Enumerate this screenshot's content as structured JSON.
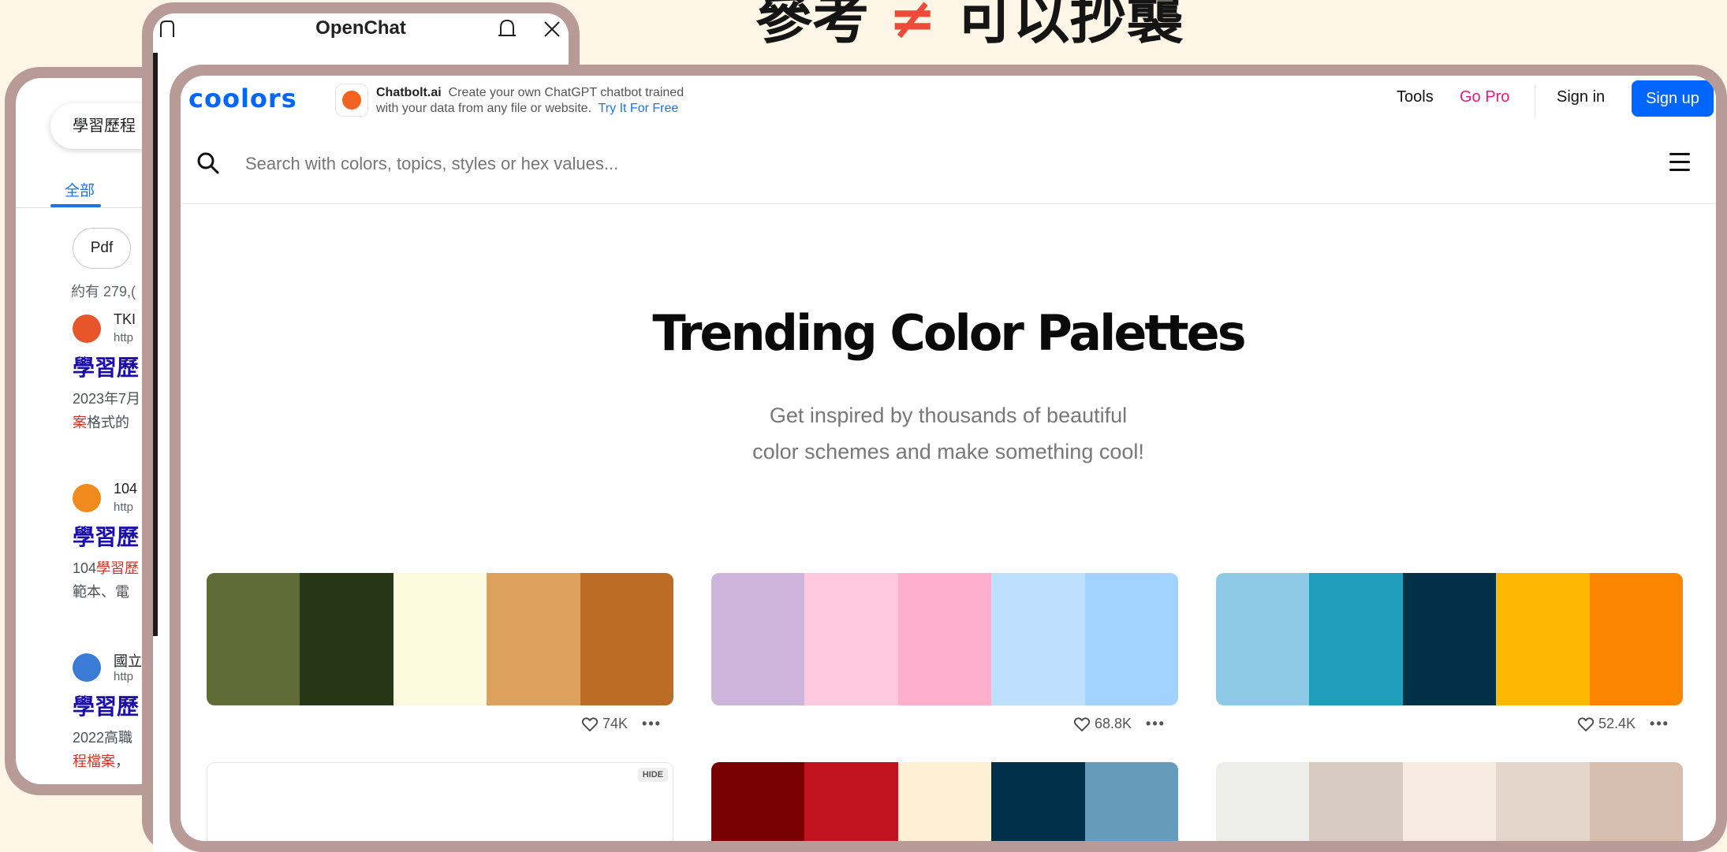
{
  "headline": {
    "left": "參考",
    "symbol": "≠",
    "right": "可以抄襲"
  },
  "search_window": {
    "query": "學習歷程",
    "tab_all": "全部",
    "chip_pdf": "Pdf",
    "result_count": "約有 279,(",
    "results": [
      {
        "site": "TKI",
        "url": "http",
        "title": "學習歷",
        "snippet1": "2023年7月",
        "snippet2_hl": "案",
        "snippet2": "格式的",
        "favicon_color": "#e8552a"
      },
      {
        "site": "104",
        "url": "http",
        "title": "學習歷",
        "snippet1": "104",
        "snippet1_hl": "學習歷",
        "snippet2": "範本、電",
        "favicon_color": "#f08a1d"
      },
      {
        "site": "國立",
        "url": "http",
        "title": "學習歷",
        "snippet1": "2022高職",
        "snippet2_hl": "程檔案",
        "snippet2": "，",
        "favicon_color": "#3a7bd5"
      }
    ]
  },
  "chat_window": {
    "title": "OpenChat"
  },
  "coolors": {
    "logo": "coolors",
    "ad": {
      "brand": "Chatbolt.ai",
      "line1": "Create your own ChatGPT chatbot trained",
      "line2": "with your data from any file or website.",
      "cta": "Try It For Free"
    },
    "nav": {
      "tools": "Tools",
      "go_pro": "Go Pro",
      "sign_in": "Sign in",
      "sign_up": "Sign up"
    },
    "search": {
      "placeholder": "Search with colors, topics, styles or hex values..."
    },
    "hero": {
      "title": "Trending Color Palettes",
      "sub1": "Get inspired by thousands of beautiful",
      "sub2": "color schemes and make something cool!"
    },
    "palettes": [
      {
        "colors": [
          "#606c38",
          "#283618",
          "#fefae0",
          "#dda15e",
          "#bc6c25"
        ],
        "likes": "74K"
      },
      {
        "colors": [
          "#cdb4db",
          "#ffc8dd",
          "#ffafcc",
          "#bde0fe",
          "#a2d2ff"
        ],
        "likes": "68.8K"
      },
      {
        "colors": [
          "#8ecae6",
          "#219ebc",
          "#023047",
          "#ffb703",
          "#fb8500"
        ],
        "likes": "52.4K"
      },
      {
        "colors": [
          "#ffffff"
        ],
        "hide_label": "HIDE"
      },
      {
        "colors": [
          "#780000",
          "#c1121f",
          "#fdf0d5",
          "#003049",
          "#669bbc"
        ]
      },
      {
        "colors": [
          "#edede9",
          "#d6ccc2",
          "#f5ebe0",
          "#e3d5ca",
          "#d5bdaf"
        ]
      }
    ]
  }
}
